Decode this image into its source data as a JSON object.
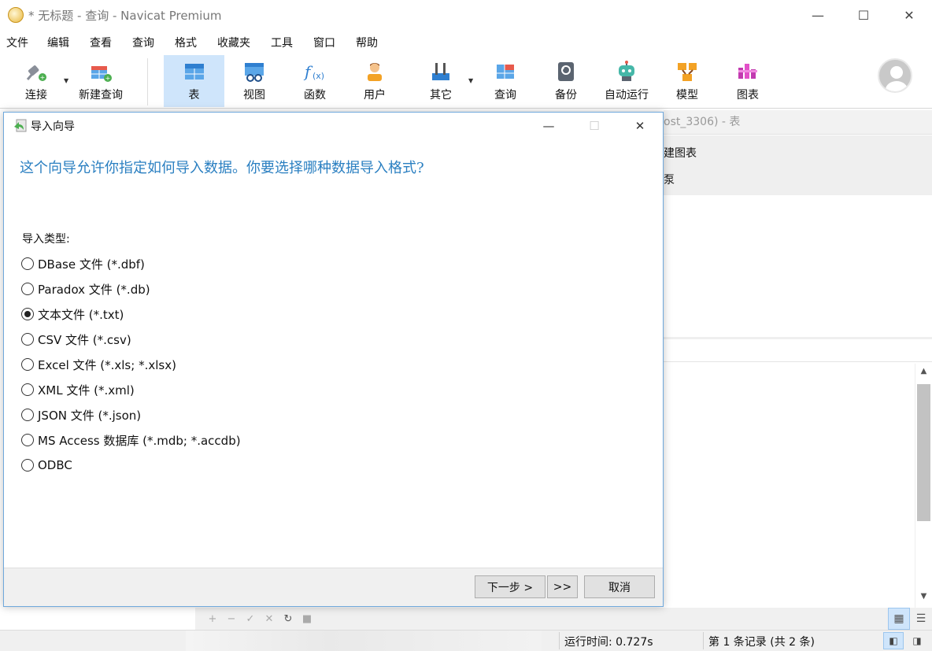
{
  "window": {
    "title": "* 无标题 - 查询 - Navicat Premium",
    "minimize": "—",
    "maximize": "☐",
    "close": "✕"
  },
  "menu": [
    "文件",
    "编辑",
    "查看",
    "查询",
    "格式",
    "收藏夹",
    "工具",
    "窗口",
    "帮助"
  ],
  "toolbar": {
    "connect": "连接",
    "new_query": "新建查询",
    "table": "表",
    "view": "视图",
    "function": "函数",
    "user": "用户",
    "other": "其它",
    "query": "查询",
    "backup": "备份",
    "automation": "自动运行",
    "model": "模型",
    "chart": "图表"
  },
  "background": {
    "tab_text": "ost_3306) - 表",
    "sub_line1": "建图表",
    "sub_line2": "泵"
  },
  "dialog": {
    "title": "导入向导",
    "heading": "这个向导允许你指定如何导入数据。你要选择哪种数据导入格式?",
    "import_type_label": "导入类型:",
    "options": [
      {
        "label": "DBase 文件 (*.dbf)",
        "checked": false
      },
      {
        "label": "Paradox 文件 (*.db)",
        "checked": false
      },
      {
        "label": "文本文件 (*.txt)",
        "checked": true
      },
      {
        "label": "CSV 文件 (*.csv)",
        "checked": false
      },
      {
        "label": "Excel 文件 (*.xls; *.xlsx)",
        "checked": false
      },
      {
        "label": "XML 文件 (*.xml)",
        "checked": false
      },
      {
        "label": "JSON 文件 (*.json)",
        "checked": false
      },
      {
        "label": "MS Access 数据库 (*.mdb; *.accdb)",
        "checked": false
      },
      {
        "label": "ODBC",
        "checked": false
      }
    ],
    "next_button": "下一步 >",
    "finish_button": ">>",
    "cancel_button": "取消"
  },
  "status": {
    "run_time": "运行时间: 0.727s",
    "record": "第 1 条记录 (共 2 条)"
  },
  "colors": {
    "accent": "#2a7fc1",
    "active_tool": "#cfe5fb"
  }
}
